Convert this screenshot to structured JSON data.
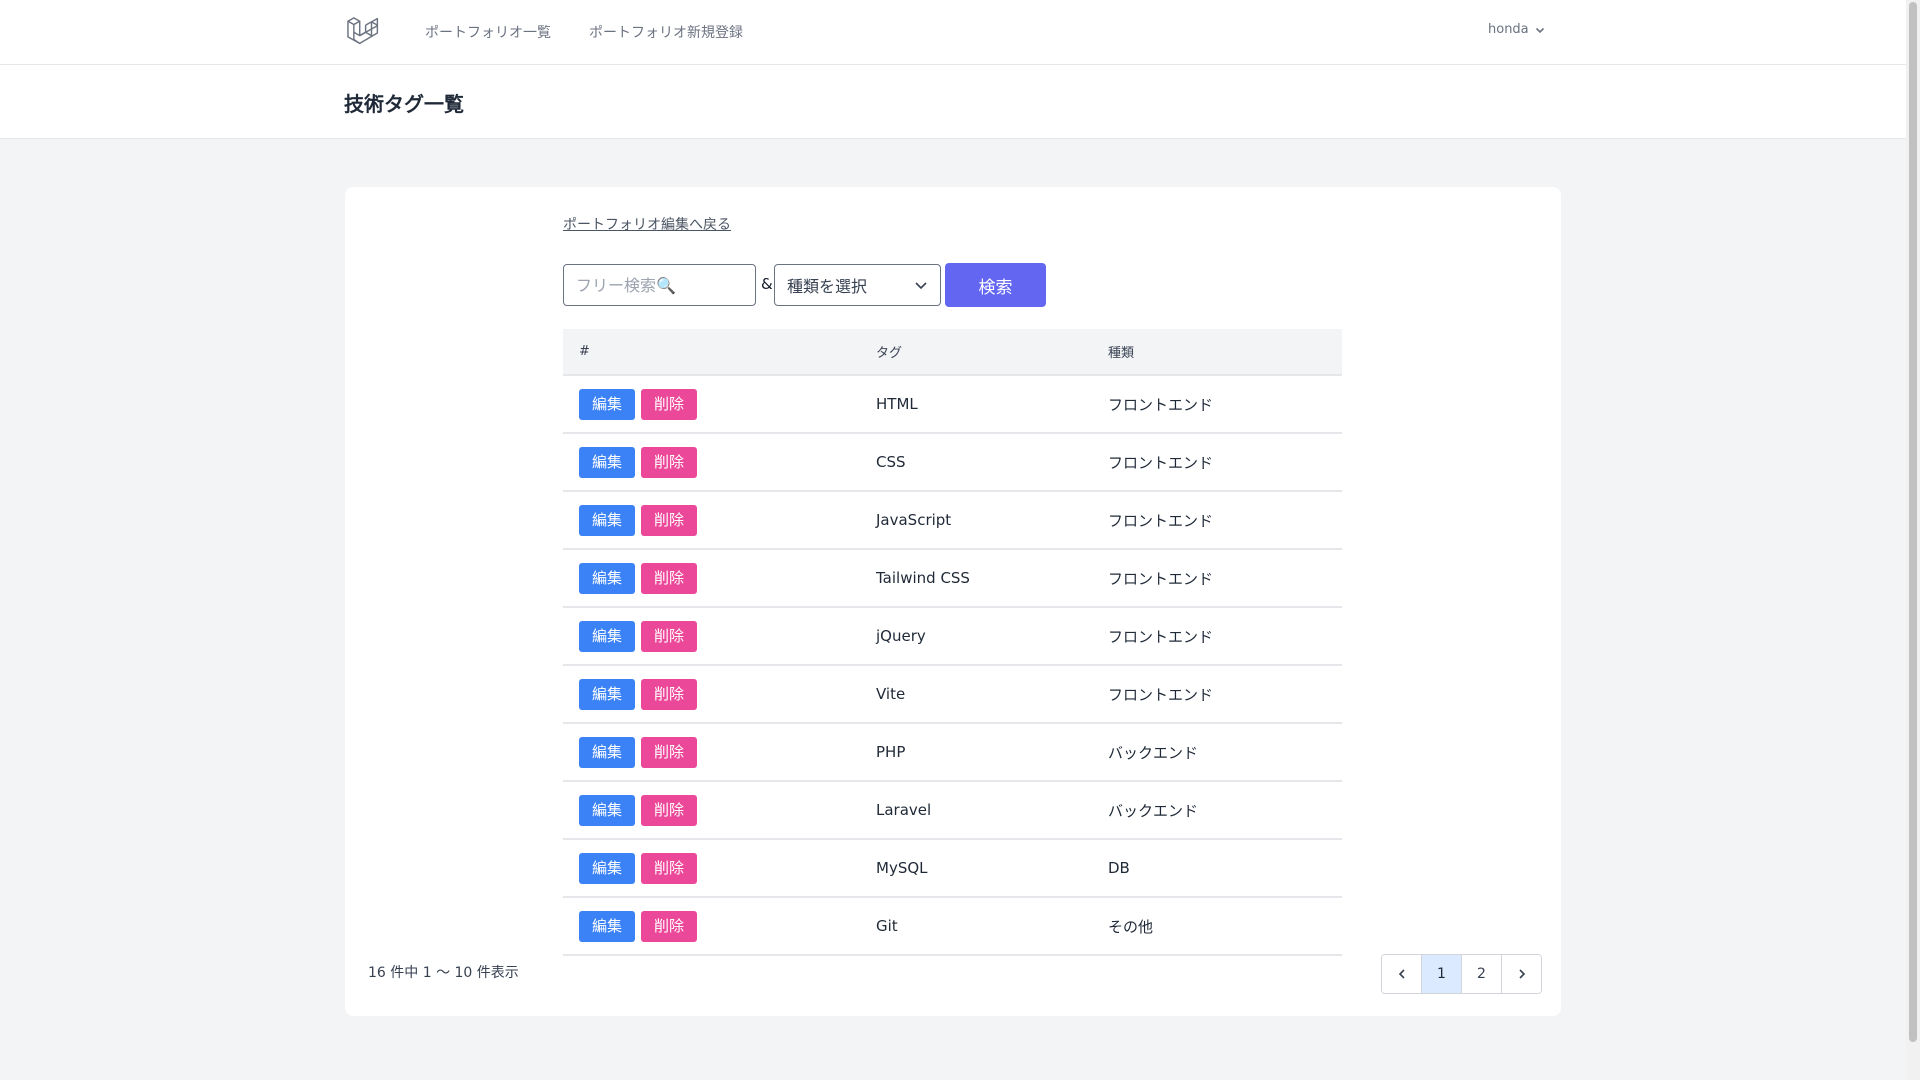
{
  "nav": {
    "links": [
      "ポートフォリオ一覧",
      "ポートフォリオ新規登録"
    ],
    "user": "honda",
    "logo_icon": "laravel-logo-icon"
  },
  "header": {
    "title": "技術タグ一覧"
  },
  "main": {
    "back_link": "ポートフォリオ編集へ戻る",
    "search": {
      "placeholder": "フリー検索🔍",
      "amp": "&",
      "kind_select": "種類を選択",
      "button": "検索"
    },
    "table": {
      "headers": [
        "#",
        "タグ",
        "種類"
      ],
      "edit_label": "編集",
      "delete_label": "削除",
      "rows": [
        {
          "tag": "HTML",
          "kind": "フロントエンド"
        },
        {
          "tag": "CSS",
          "kind": "フロントエンド"
        },
        {
          "tag": "JavaScript",
          "kind": "フロントエンド"
        },
        {
          "tag": "Tailwind CSS",
          "kind": "フロントエンド"
        },
        {
          "tag": "jQuery",
          "kind": "フロントエンド"
        },
        {
          "tag": "Vite",
          "kind": "フロントエンド"
        },
        {
          "tag": "PHP",
          "kind": "バックエンド"
        },
        {
          "tag": "Laravel",
          "kind": "バックエンド"
        },
        {
          "tag": "MySQL",
          "kind": "DB"
        },
        {
          "tag": "Git",
          "kind": "その他"
        }
      ]
    },
    "count_text": "16 件中 1 〜 10 件表示",
    "pagination": {
      "pages": [
        "1",
        "2"
      ],
      "current": "1"
    }
  },
  "colors": {
    "primary": "#6366f1",
    "edit": "#3b82f6",
    "delete": "#ec4899",
    "background": "#f3f4f6"
  }
}
